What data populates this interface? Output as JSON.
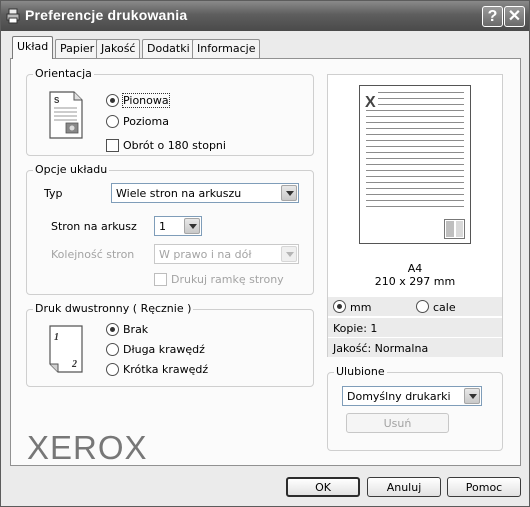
{
  "window": {
    "title": "Preferencje drukowania",
    "help_glyph": "?",
    "close_glyph": "✕"
  },
  "tabs": [
    "Układ",
    "Papier",
    "Jakość",
    "Dodatki",
    "Informacje"
  ],
  "orientation": {
    "legend": "Orientacja",
    "portrait": "Pionowa",
    "landscape": "Pozioma",
    "rotate": "Obrót o 180 stopni",
    "selected": "portrait"
  },
  "layout": {
    "legend": "Opcje układu",
    "type_label": "Typ",
    "type_value": "Wiele stron na arkuszu",
    "pages_label": "Stron na arkusz",
    "pages_value": "1",
    "order_label": "Kolejność stron",
    "order_value": "W prawo i na dół",
    "border_label": "Drukuj ramkę strony"
  },
  "duplex": {
    "legend": "Druk dwustronny ( Ręcznie )",
    "none": "Brak",
    "long_edge": "Długa krawędź",
    "short_edge": "Krótka krawędź",
    "selected": "none"
  },
  "preview": {
    "paper": "A4",
    "size": "210 x 297 mm",
    "unit_mm": "mm",
    "unit_in": "cale",
    "copies": "Kopie: 1",
    "quality": "Jakość: Normalna"
  },
  "favorites": {
    "legend": "Ulubione",
    "value": "Domyślny drukarki",
    "delete_label": "Usuń"
  },
  "brand": "XEROX",
  "buttons": {
    "ok": "OK",
    "cancel": "Anuluj",
    "help": "Pomoc"
  }
}
